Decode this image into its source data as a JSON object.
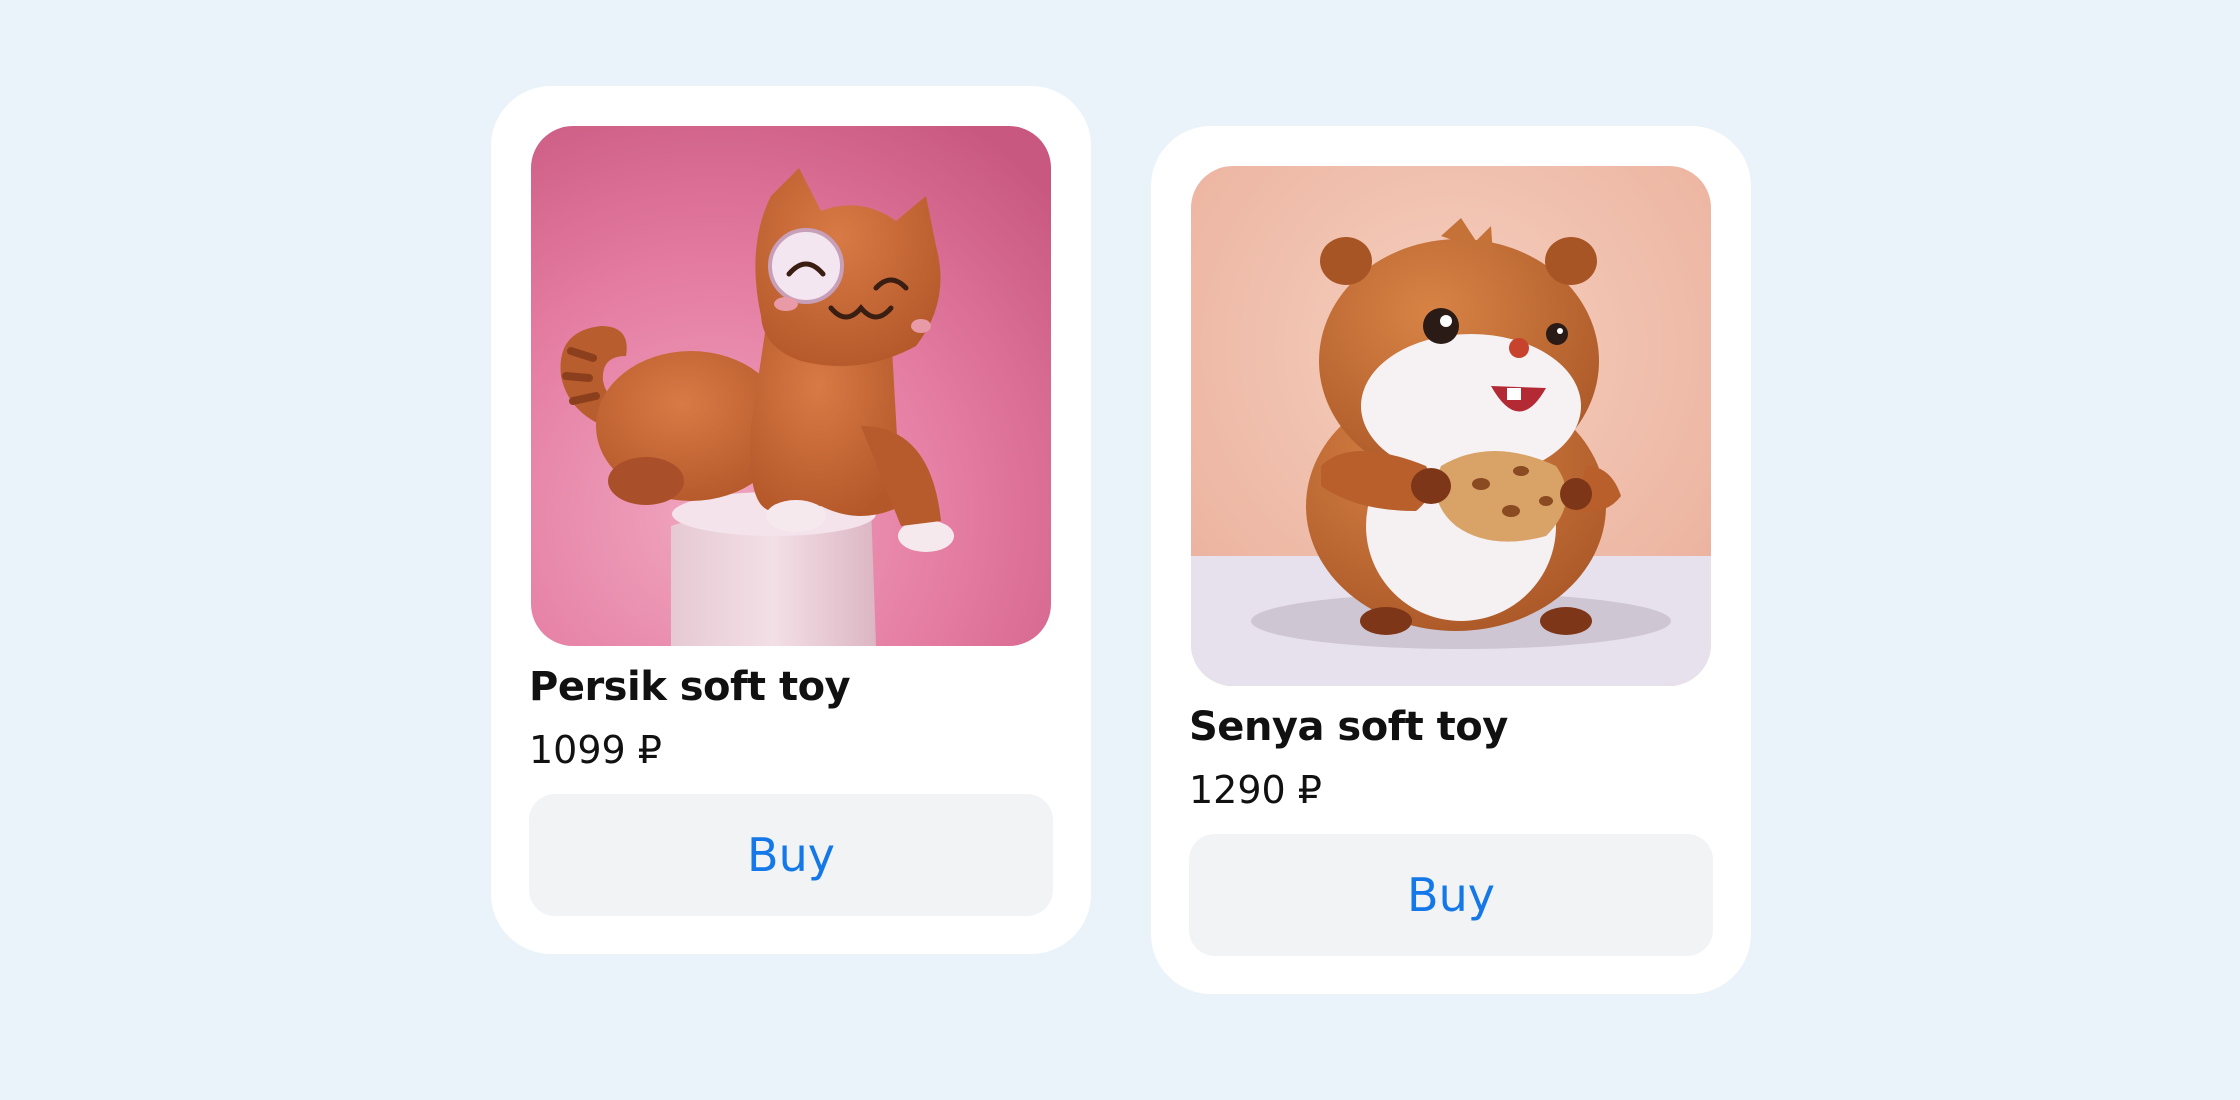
{
  "products": [
    {
      "title": "Persik soft toy",
      "price": "1099 ₽",
      "button_label": "Buy",
      "image_subject": "orange plush cat sitting on a white pedestal, pink background"
    },
    {
      "title": "Senya soft toy",
      "price": "1290 ₽",
      "button_label": "Buy",
      "image_subject": "orange and white plush hamster holding a cookie, peach background"
    }
  ],
  "colors": {
    "page_background": "#ebf3fa",
    "card_background": "#ffffff",
    "button_background": "#f1f3f5",
    "button_text": "#1478e8",
    "text": "#111111"
  }
}
